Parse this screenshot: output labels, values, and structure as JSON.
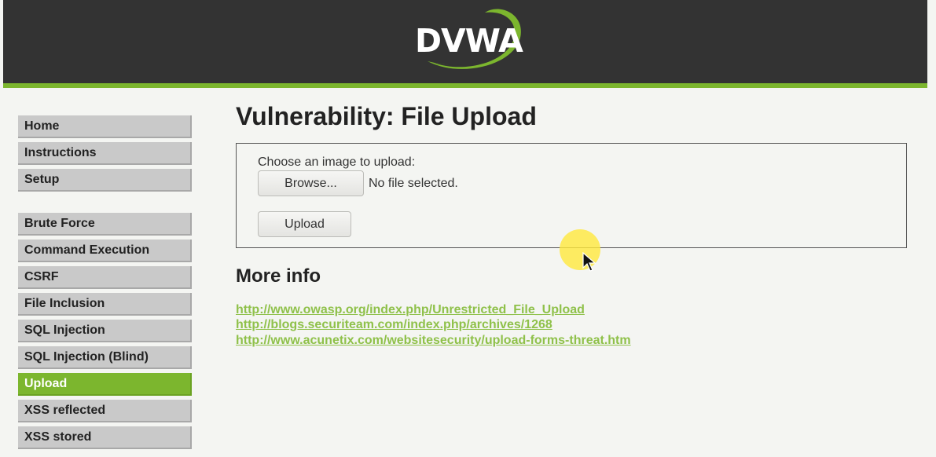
{
  "header": {
    "logo_text": "DVWA",
    "background_color": "#333333",
    "accent_color": "#7cb62e"
  },
  "menu": {
    "group1": [
      "Home",
      "Instructions",
      "Setup"
    ],
    "group2": [
      "Brute Force",
      "Command Execution",
      "CSRF",
      "File Inclusion",
      "SQL Injection",
      "SQL Injection (Blind)",
      "Upload",
      "XSS reflected",
      "XSS stored"
    ],
    "selected": "Upload"
  },
  "main": {
    "title": "Vulnerability: File Upload",
    "form": {
      "prompt": "Choose an image to upload:",
      "browse_label": "Browse...",
      "file_status": "No file selected.",
      "upload_label": "Upload"
    },
    "more_info": {
      "heading": "More info",
      "links": [
        "http://www.owasp.org/index.php/Unrestricted_File_Upload",
        "http://blogs.securiteam.com/index.php/archives/1268",
        "http://www.acunetix.com/websitesecurity/upload-forms-threat.htm"
      ]
    }
  },
  "icons": {
    "cursor": "mouse-pointer-icon",
    "highlight": "click-highlight"
  }
}
